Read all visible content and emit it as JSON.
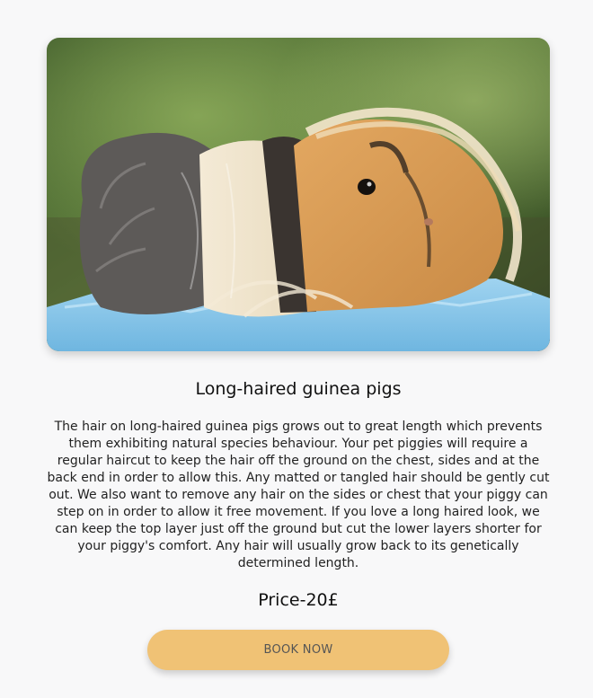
{
  "product": {
    "title": "Long-haired guinea pigs",
    "description": "The hair on long-haired guinea pigs grows out to great length which prevents them exhibiting natural species behaviour. Your pet piggies will require a regular haircut to keep the hair off the ground on the chest, sides and at the back end in order to allow this. Any matted or tangled hair should be gently cut out. We also want to remove any hair on the sides or chest that your piggy can step on in order to allow it free movement. If you love a long haired look, we can keep the top layer just off the ground but cut the lower layers shorter for your piggy's comfort. Any hair will usually grow back to its genetically determined length.",
    "price": "Price-20£",
    "book_label": "BOOK NOW"
  },
  "colors": {
    "button": "#f0c275",
    "background": "#f8f8f9"
  }
}
